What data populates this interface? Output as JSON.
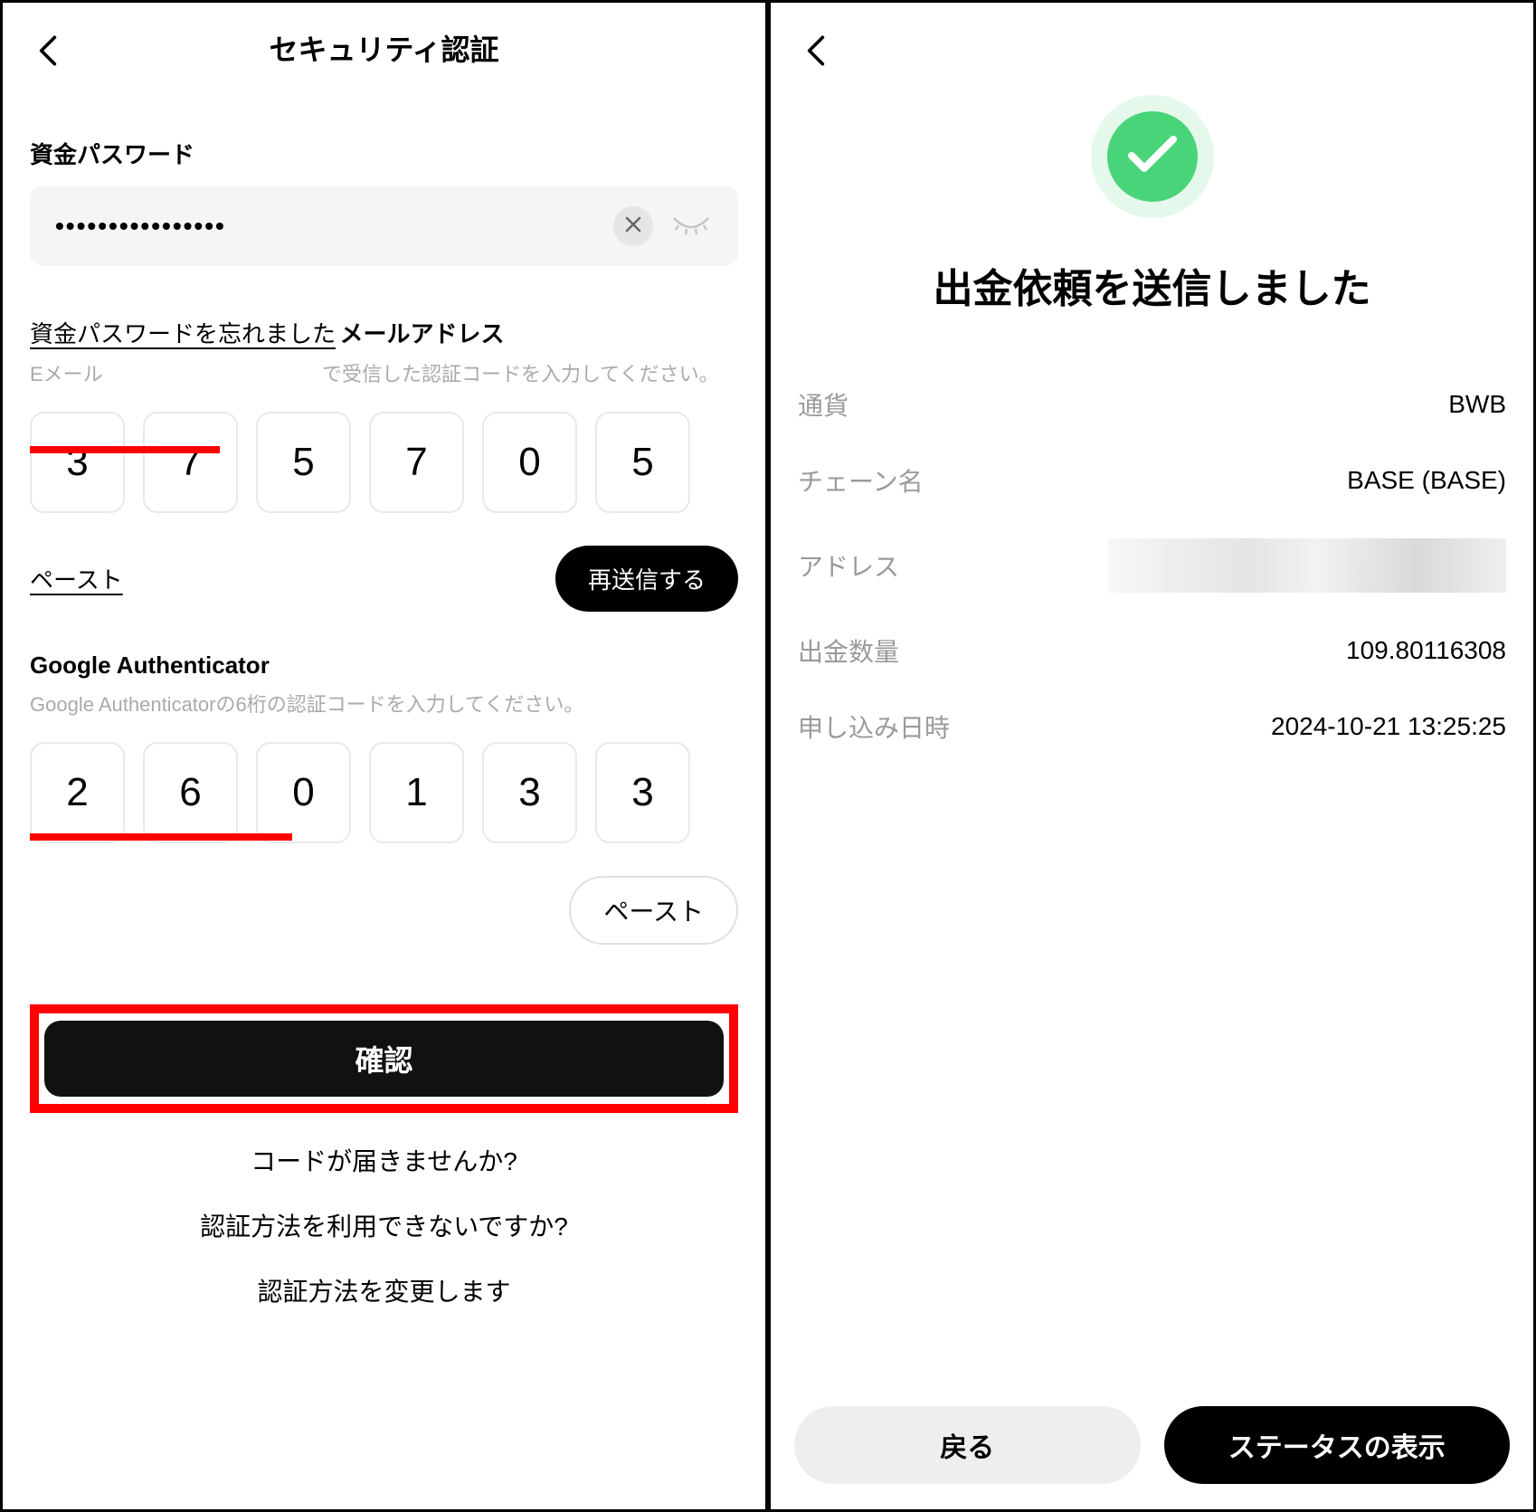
{
  "left": {
    "header_title": "セキュリティ認証",
    "fund_password": {
      "label": "資金パスワード",
      "value_mask": "••••••••••••••••",
      "forgot": "資金パスワードを忘れました"
    },
    "email": {
      "label": "メールアドレス",
      "hint_prefix": "Eメール",
      "hint_suffix": "で受信した認証コードを入力してください。",
      "code": [
        "3",
        "7",
        "5",
        "7",
        "0",
        "5"
      ],
      "paste": "ペースト",
      "resend": "再送信する"
    },
    "authenticator": {
      "label": "Google Authenticator",
      "hint": "Google Authenticatorの6桁の認証コードを入力してください。",
      "code": [
        "2",
        "6",
        "0",
        "1",
        "3",
        "3"
      ],
      "paste": "ペースト"
    },
    "confirm": "確認",
    "footer": {
      "no_code": "コードが届きませんか?",
      "cannot_use": "認証方法を利用できないですか?",
      "change": "認証方法を変更します"
    }
  },
  "right": {
    "title": "出金依頼を送信しました",
    "rows": {
      "currency_label": "通貨",
      "currency_value": "BWB",
      "chain_label": "チェーン名",
      "chain_value": "BASE (BASE)",
      "address_label": "アドレス",
      "amount_label": "出金数量",
      "amount_value": "109.80116308",
      "time_label": "申し込み日時",
      "time_value": "2024-10-21 13:25:25"
    },
    "buttons": {
      "back": "戻る",
      "status": "ステータスの表示"
    }
  }
}
